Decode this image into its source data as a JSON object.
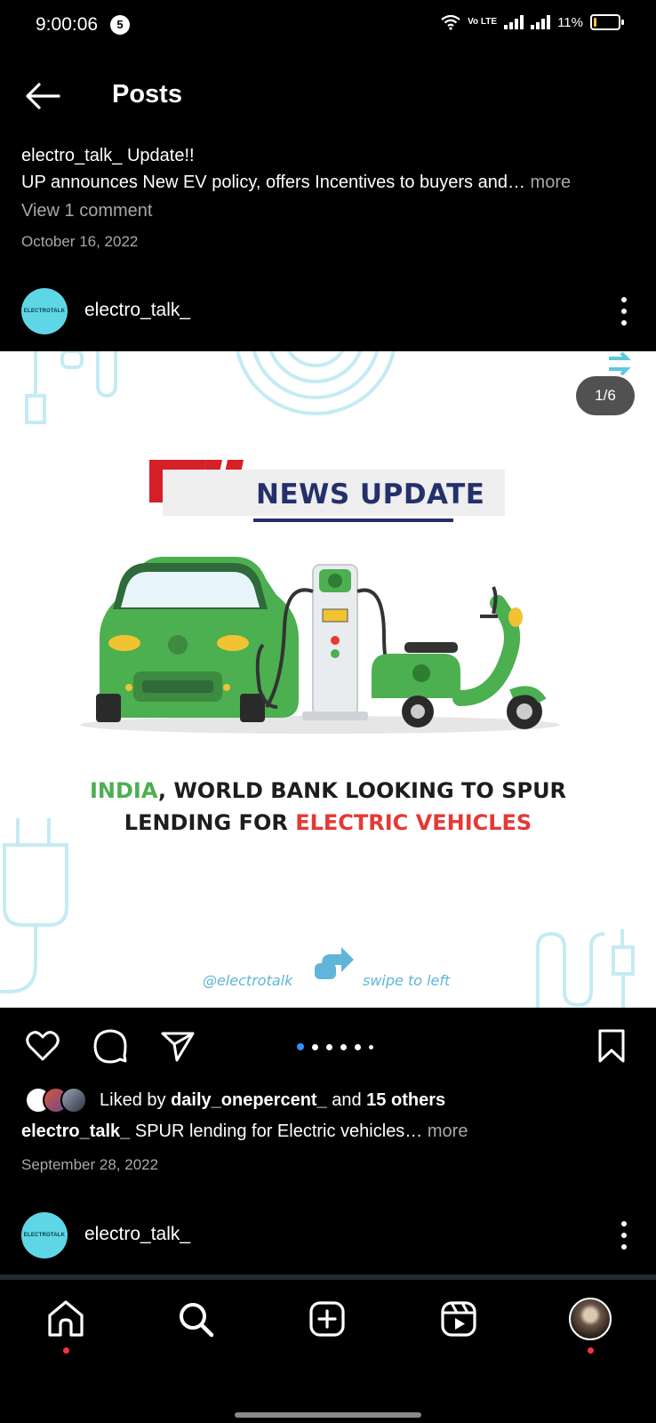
{
  "status_bar": {
    "time": "9:00:06",
    "notification_count": "5",
    "volte_label": "Vo LTE",
    "battery_percent": "11%",
    "battery_level": 0.11
  },
  "header": {
    "title": "Posts"
  },
  "previous_post": {
    "username": "electro_talk_",
    "caption_line1": "Update!!",
    "caption_line2": "UP announces New EV policy, offers Incentives to buyers and…",
    "more_label": "more",
    "view_comments": "View 1 comment",
    "date": "October 16, 2022"
  },
  "post": {
    "username": "electro_talk_",
    "avatar_text": "ELECTROTALK",
    "image": {
      "counter": "1/6",
      "banner_title": "NEWS UPDATE",
      "headline_line1_highlight": "INDIA",
      "headline_line1_rest": ", WORLD BANK LOOKING TO SPUR",
      "headline_line2_start": "LENDING FOR ",
      "headline_line2_highlight": "ELECTRIC VEHICLES",
      "footer_handle": "@electrotalk",
      "footer_swipe": "swipe to left"
    },
    "carousel": {
      "total": 6,
      "active": 1
    },
    "likes": {
      "prefix": "Liked by ",
      "first_liker": "daily_onepercent_",
      "and": " and ",
      "others": "15 others"
    },
    "caption": {
      "username": "electro_talk_",
      "text": " SPUR lending for Electric vehicles…",
      "more_label": "more"
    },
    "date": "September 28, 2022"
  },
  "next_post": {
    "username": "electro_talk_",
    "avatar_text": "ELECTROTALK"
  },
  "colors": {
    "accent_blue": "#2f93f5",
    "notification_red": "#ff3040",
    "ev_green": "#4caf50",
    "news_red": "#e53935"
  },
  "icons": {
    "back": "arrow-left-icon",
    "like": "heart-icon",
    "comment": "comment-icon",
    "share": "send-icon",
    "save": "bookmark-icon",
    "home": "home-icon",
    "search": "search-icon",
    "create": "plus-square-icon",
    "reels": "reels-icon"
  }
}
